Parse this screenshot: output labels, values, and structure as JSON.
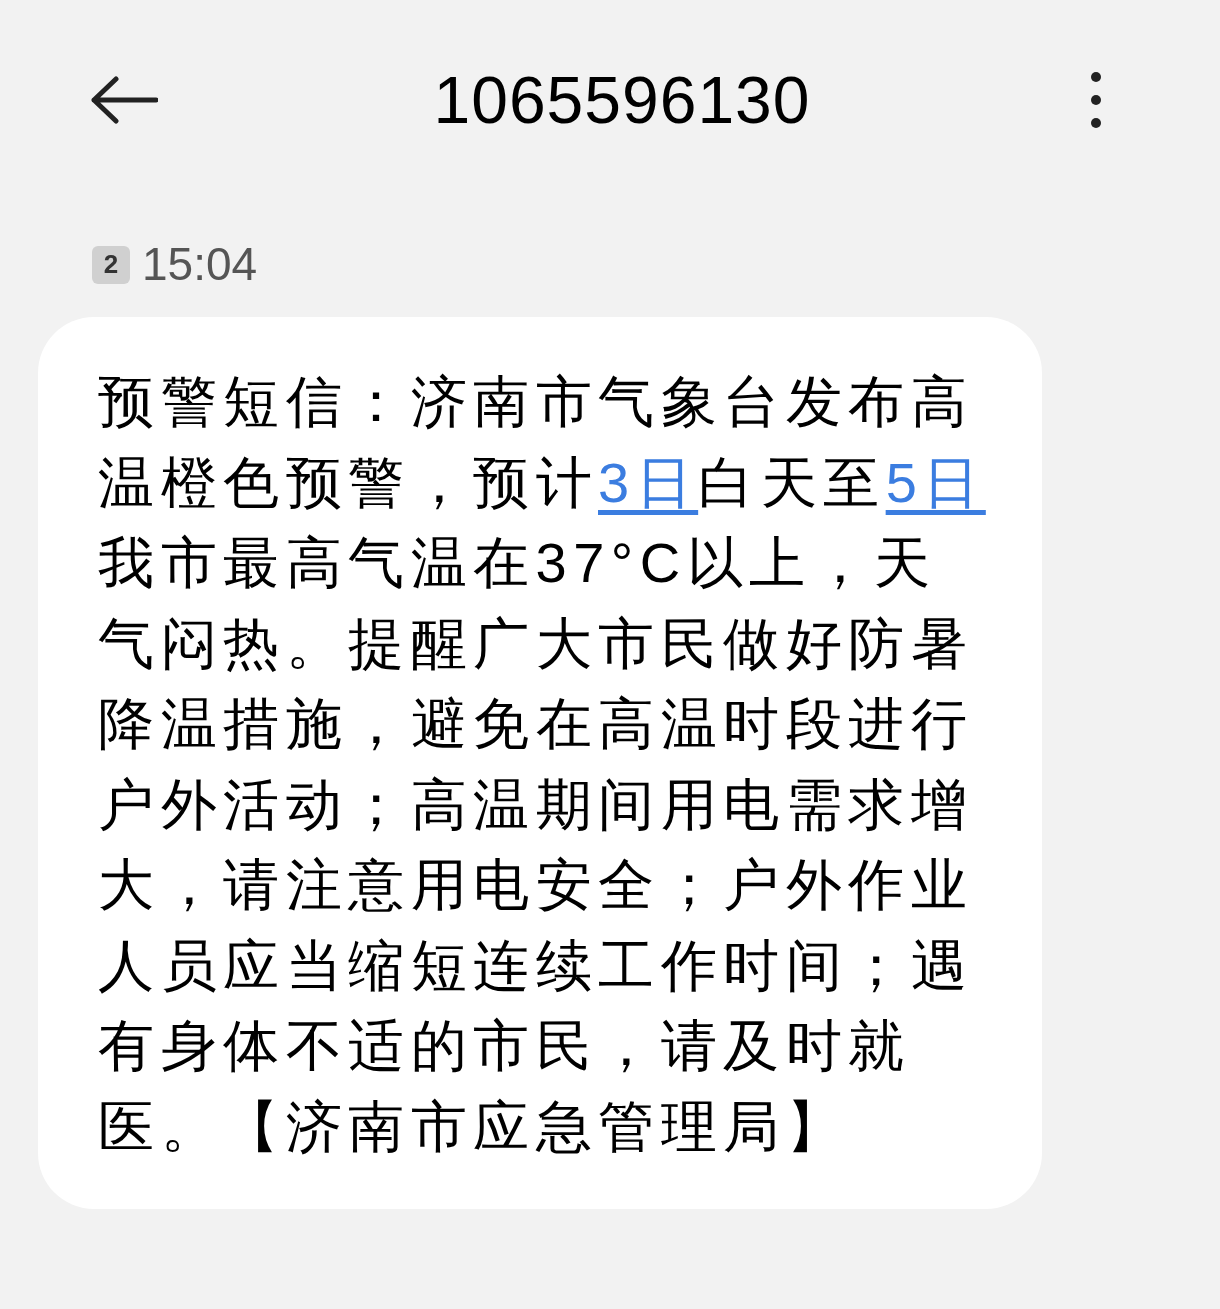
{
  "header": {
    "title": "1065596130"
  },
  "message": {
    "sim": "2",
    "time": "15:04",
    "parts": [
      {
        "kind": "text",
        "text": "预警短信：济南市气象台发布高温橙色预警，预计"
      },
      {
        "kind": "link",
        "text": "3日"
      },
      {
        "kind": "text",
        "text": "白天至"
      },
      {
        "kind": "link",
        "text": "5日"
      },
      {
        "kind": "text",
        "text": "我市最高气温在37°C以上，天气闷热。提醒广大市民做好防暑降温措施，避免在高温时段进行户外活动；高温期间用电需求增大，请注意用电安全；户外作业人员应当缩短连续工作时间；遇有身体不适的市民，请及时就医。【济南市应急管理局】"
      }
    ]
  }
}
